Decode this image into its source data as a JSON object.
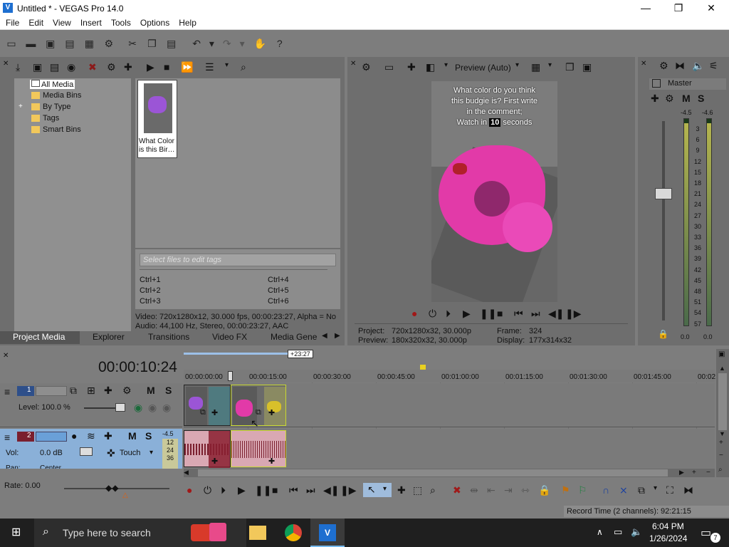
{
  "window": {
    "title": "Untitled * - VEGAS Pro 14.0",
    "minimize": "—",
    "maximize": "❐",
    "close": "✕"
  },
  "menu": [
    "File",
    "Edit",
    "View",
    "Insert",
    "Tools",
    "Options",
    "Help"
  ],
  "media_tree": {
    "items": [
      "All Media",
      "Media Bins",
      "By Type",
      "Tags",
      "Smart Bins"
    ],
    "expander": "+"
  },
  "media_file": {
    "name": "What Color is this Bir…"
  },
  "tags": {
    "placeholder": "Select files to edit tags",
    "shortcuts_left": [
      "Ctrl+1",
      "Ctrl+2",
      "Ctrl+3"
    ],
    "shortcuts_right": [
      "Ctrl+4",
      "Ctrl+5",
      "Ctrl+6"
    ]
  },
  "media_info": {
    "video": "Video: 720x1280x12, 30.000 fps, 00:00:23:27, Alpha = No",
    "audio": "Audio: 44,100 Hz, Stereo, 00:00:23:27, AAC"
  },
  "bottom_tabs": [
    "Project Media",
    "Explorer",
    "Transitions",
    "Video FX",
    "Media Genera"
  ],
  "preview": {
    "mode_label": "Preview (Auto)",
    "overlay_text": [
      "What color do you think",
      "this budgie is? First write",
      "in the comment;",
      "Watch in",
      "seconds"
    ],
    "overlay_number": "10",
    "project_label": "Project:",
    "project_value": "720x1280x32, 30.000p",
    "preview_label": "Preview:",
    "preview_value": "180x320x32, 30.000p",
    "frame_label": "Frame:",
    "frame_value": "324",
    "display_label": "Display:",
    "display_value": "177x314x32"
  },
  "master": {
    "label": "Master",
    "m": "M",
    "s": "S",
    "peak_left": "-4.5",
    "peak_right": "-4.6",
    "scale": [
      "3",
      "6",
      "9",
      "12",
      "15",
      "18",
      "21",
      "24",
      "27",
      "30",
      "33",
      "36",
      "39",
      "42",
      "45",
      "48",
      "51",
      "54",
      "57"
    ],
    "bottom_left": "0.0",
    "bottom_right": "0.0"
  },
  "timeline": {
    "timecode": "00:00:10:24",
    "loop_marker": "+23:27",
    "ruler_labels": [
      "00:00:00:00",
      "00:00:15:00",
      "00:00:30:00",
      "00:00:45:00",
      "00:01:00:00",
      "00:01:15:00",
      "00:01:30:00",
      "00:01:45:00",
      "00:02"
    ],
    "track1": {
      "number": "1",
      "m": "M",
      "s": "S",
      "level": "Level: 100.0 %"
    },
    "track2": {
      "number": "2",
      "m": "M",
      "s": "S",
      "vol_label": "Vol:",
      "vol_value": "0.0 dB",
      "touch": "Touch",
      "pan": "Pan:",
      "pan_value": "Center",
      "meter_top": "-4.5",
      "meter_vals": [
        "12",
        "24",
        "36"
      ]
    }
  },
  "rate": "Rate: 0.00",
  "record_time": "Record Time (2 channels): 92:21:15",
  "taskbar": {
    "search_placeholder": "Type here to search",
    "time": "6:04 PM",
    "date": "1/26/2024",
    "notifications": "7"
  },
  "colors": {
    "bg": "#7d7d7d",
    "video_track": "#2e4f8a",
    "audio_track": "#7a1f2e",
    "budgie": "#e23aa8",
    "selection": "#ffffff"
  }
}
